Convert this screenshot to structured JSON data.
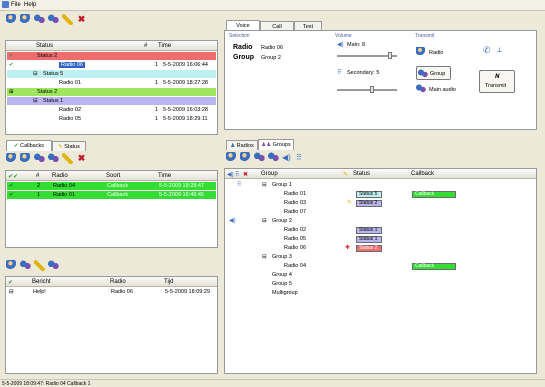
{
  "menu": {
    "file": "File",
    "help": "Help"
  },
  "status_panel": {
    "headers": {
      "status": "Status",
      "num": "#",
      "time": "Time"
    },
    "rows": [
      {
        "label": "Status 2",
        "num": "",
        "time": "",
        "style": "red-group"
      },
      {
        "label": "Radio 06",
        "num": "1",
        "time": "5-5-2009 16:06:44",
        "style": "selected"
      },
      {
        "label": "Status 5",
        "num": "",
        "time": "",
        "style": "cyan-group"
      },
      {
        "label": "Radio 01",
        "num": "1",
        "time": "5-5-2009 18:27:28",
        "style": "plain"
      },
      {
        "label": "Status 2",
        "num": "",
        "time": "",
        "style": "lime-group"
      },
      {
        "label": "Status 1",
        "num": "",
        "time": "",
        "style": "blue-group"
      },
      {
        "label": "Radio 02",
        "num": "1",
        "time": "5-5-2009 16:03:28",
        "style": "plain"
      },
      {
        "label": "Radio 05",
        "num": "1",
        "time": "5-5-2009 18:29:11",
        "style": "plain"
      }
    ]
  },
  "callback_panel": {
    "tabs": [
      "Callbacks",
      "Status"
    ],
    "headers": {
      "num": "#",
      "radio": "Radio",
      "soort": "Soort",
      "time": "Time"
    },
    "rows": [
      {
        "num": "2",
        "radio": "Radio 04",
        "soort": "Callback",
        "time": "5-5-2009 18:28:47"
      },
      {
        "num": "1",
        "radio": "Radio 01",
        "soort": "Callback",
        "time": "5-5-2009 16:49:45"
      }
    ]
  },
  "message_panel": {
    "headers": {
      "bericht": "Bericht",
      "radio": "Radio",
      "tijd": "Tijd"
    },
    "rows": [
      {
        "bericht": "Help!",
        "radio": "Radio 06",
        "tijd": "5-5-2009 18:09:29"
      }
    ]
  },
  "control_panel": {
    "tabs": [
      "Voice",
      "Call",
      "Text"
    ],
    "selection_label": "Selection",
    "radio_label": "Radio",
    "radio_value": "Radio 06",
    "group_label": "Group",
    "group_value": "Group 2",
    "volume_label": "Volume",
    "main_volume": "Main: 8",
    "secondary_volume": "Secondary: 5",
    "transmit_label": "Transmit",
    "tx_radio": "Radio",
    "tx_group": "Group",
    "tx_main_audio": "Main audio",
    "transmit_button": "Transmit"
  },
  "groups_panel": {
    "tabs": [
      "Radios",
      "Groups"
    ],
    "headers": {
      "group": "Group",
      "status": "Status",
      "callback": "Callback"
    },
    "rows": [
      {
        "label": "Group 1",
        "level": 1,
        "status": "",
        "callback": ""
      },
      {
        "label": "Radio 01",
        "level": 2,
        "status": "Status 5",
        "callback": "Callback"
      },
      {
        "label": "Radio 03",
        "level": 2,
        "status": "Status 2",
        "callback": ""
      },
      {
        "label": "Radio 07",
        "level": 2,
        "status": "",
        "callback": ""
      },
      {
        "label": "Group 2",
        "level": 1,
        "status": "",
        "callback": ""
      },
      {
        "label": "Radio 02",
        "level": 2,
        "status": "Status 1",
        "callback": ""
      },
      {
        "label": "Radio 05",
        "level": 2,
        "status": "Status 1",
        "callback": ""
      },
      {
        "label": "Radio 06",
        "level": 2,
        "status": "Status 2",
        "callback": ""
      },
      {
        "label": "Group 3",
        "level": 1,
        "status": "",
        "callback": ""
      },
      {
        "label": "Radio 04",
        "level": 2,
        "status": "",
        "callback": "Callback"
      },
      {
        "label": "Group 4",
        "level": 1,
        "status": "",
        "callback": ""
      },
      {
        "label": "Group 5",
        "level": 1,
        "status": "",
        "callback": ""
      },
      {
        "label": "Multigroup",
        "level": 1,
        "status": "",
        "callback": ""
      }
    ]
  },
  "statusbar": {
    "text": "5-5-2009 18:09:47: Radio 04 Callback 1"
  },
  "colors": {
    "red": "#ee6e6e",
    "cyan": "#bff0f0",
    "lime": "#9fe65f",
    "lavender": "#b8b4f0",
    "green": "#33dd33",
    "selected": "#3163c5"
  }
}
